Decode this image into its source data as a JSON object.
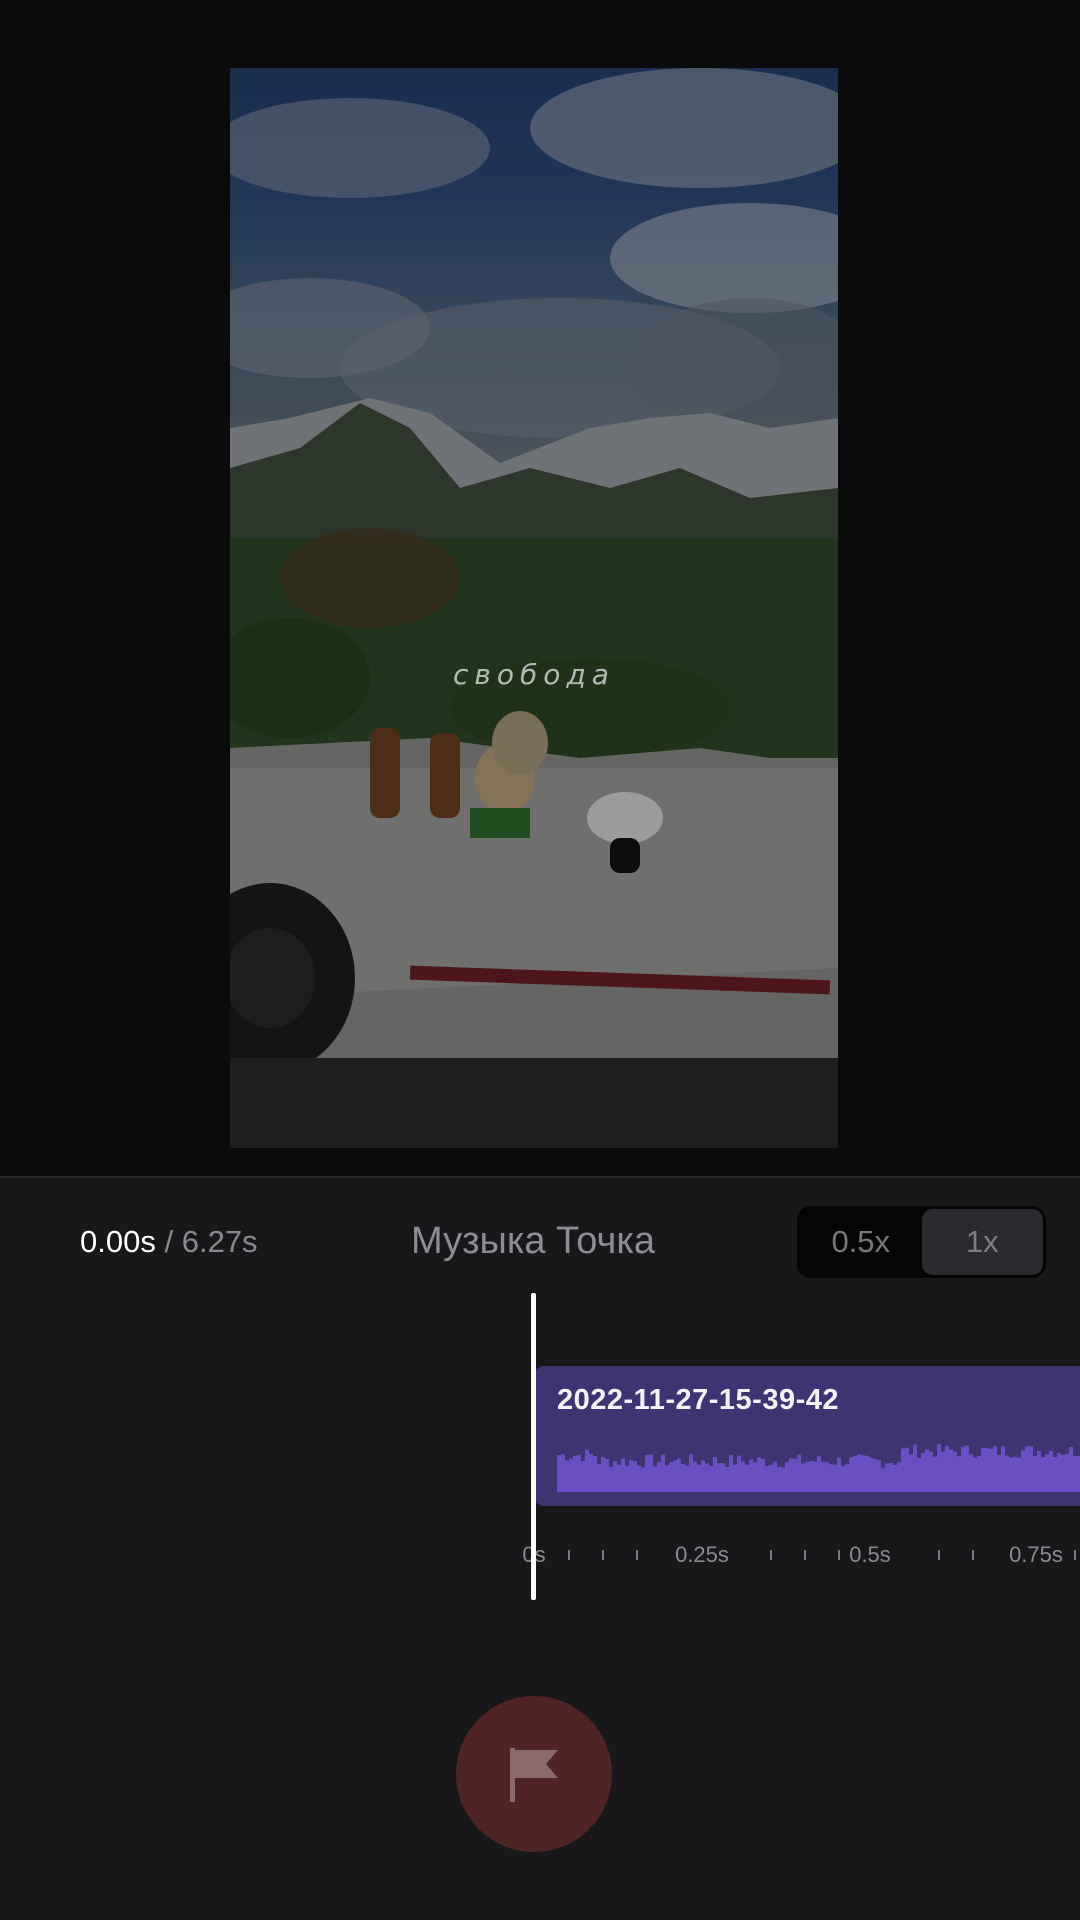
{
  "preview": {
    "overlay_caption": "свобода"
  },
  "playback": {
    "current_time": "0.00s",
    "separator": "/",
    "total_time": "6.27s"
  },
  "track": {
    "title": "Музыка Точка"
  },
  "speed_toggle": {
    "options": [
      "0.5x",
      "1x"
    ],
    "selected": "1x"
  },
  "timeline": {
    "clip_name": "2022-11-27-15-39-42",
    "ruler_labels": [
      "0s",
      "0.25s",
      "0.5s",
      "0.75s"
    ],
    "playhead_time_s": 0
  },
  "actions": {
    "flag_icon": "flag-icon"
  },
  "colors": {
    "clip_bg": "#3e3472",
    "waveform": "#6a4fc3",
    "flag_button": "#4f2424",
    "panel_bg": "#18181b"
  }
}
